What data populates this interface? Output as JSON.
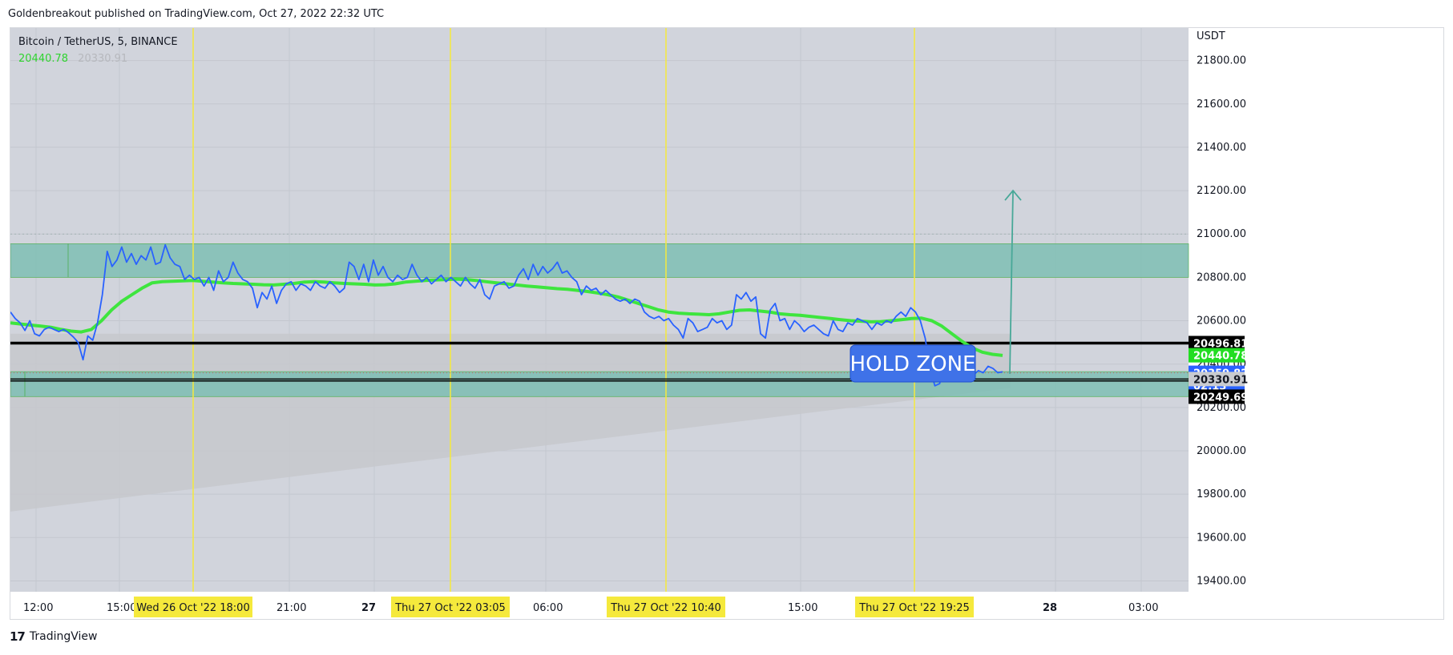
{
  "header": {
    "published": "Goldenbreakout published on TradingView.com, Oct 27, 2022 22:32 UTC"
  },
  "symbol": {
    "name": "Bitcoin / TetherUS, 5, BINANCE",
    "value_green": "20440.78",
    "value_gray": "20330.91"
  },
  "footer": {
    "logo": "17",
    "brand": "TradingView"
  },
  "annotation": {
    "hold_zone": "HOLD ZONE"
  },
  "colors": {
    "background": "#d1d4dc",
    "zone_fill": "#7fbfb5",
    "price_line": "#2962ff",
    "ma_line": "#3ee53e",
    "vertical_marker": "#f5e93c",
    "hold_zone_box": "#3f72e8",
    "arrow": "#48a898"
  },
  "chart_data": {
    "type": "line",
    "ylabel": "USDT",
    "ylim": [
      19350,
      21950
    ],
    "y_ticks": [
      "21800.00",
      "21600.00",
      "21400.00",
      "21200.00",
      "21000.00",
      "20800.00",
      "20600.00",
      "20400.00",
      "20200.00",
      "20000.00",
      "19800.00",
      "19600.00",
      "19400.00"
    ],
    "x_labels": [
      "12:00",
      "15:00",
      "21:00",
      "27",
      "06:00",
      "15:00",
      "28",
      "03:00"
    ],
    "x_markers": [
      "Wed 26 Oct '22   18:00",
      "Thu 27 Oct '22   03:05",
      "Thu 27 Oct '22   10:40",
      "Thu 27 Oct '22   19:25"
    ],
    "price_labels": [
      {
        "label": "20496.81",
        "bg": "#000000",
        "fg": "#ffffff"
      },
      {
        "label": "20440.78",
        "bg": "#22dd22",
        "fg": "#ffffff"
      },
      {
        "label": "20359.82",
        "bg": "#2962ff",
        "fg": "#ffffff"
      },
      {
        "label": "02:13",
        "bg": "#2962ff",
        "fg": "#ffffff"
      },
      {
        "label": "20330.91",
        "bg": "#c9cbd0",
        "fg": "#131722"
      },
      {
        "label": "20249.69",
        "bg": "#000000",
        "fg": "#ffffff"
      }
    ],
    "zones": [
      {
        "from": 20800,
        "to": 20955
      },
      {
        "from": 20250,
        "to": 20365
      }
    ],
    "series": [
      {
        "values": [
          20640,
          20610,
          20590,
          20555,
          20600,
          20540,
          20530,
          20560,
          20570,
          20560,
          20550,
          20560,
          20545,
          20525,
          20500,
          20420,
          20530,
          20510,
          20590,
          20720,
          20920,
          20850,
          20880,
          20940,
          20870,
          20910,
          20860,
          20900,
          20880,
          20940,
          20860,
          20870,
          20950,
          20890,
          20860,
          20850,
          20790,
          20810,
          20790,
          20800,
          20760,
          20800,
          20740,
          20830,
          20780,
          20800,
          20870,
          20820,
          20790,
          20780,
          20750,
          20660,
          20730,
          20700,
          20760,
          20680,
          20740,
          20770,
          20780,
          20740,
          20770,
          20760,
          20740,
          20780,
          20760,
          20750,
          20780,
          20760,
          20730,
          20750,
          20870,
          20850,
          20790,
          20860,
          20780,
          20880,
          20810,
          20850,
          20800,
          20780,
          20810,
          20790,
          20800,
          20860,
          20810,
          20780,
          20800,
          20770,
          20790,
          20810,
          20780,
          20800,
          20780,
          20760,
          20800,
          20770,
          20750,
          20790,
          20720,
          20700,
          20760,
          20770,
          20780,
          20750,
          20760,
          20810,
          20840,
          20790,
          20860,
          20810,
          20850,
          20820,
          20840,
          20870,
          20820,
          20830,
          20800,
          20780,
          20720,
          20760,
          20740,
          20750,
          20720,
          20740,
          20720,
          20700,
          20690,
          20700,
          20680,
          20700,
          20690,
          20640,
          20620,
          20610,
          20620,
          20600,
          20610,
          20580,
          20560,
          20520,
          20610,
          20590,
          20550,
          20560,
          20570,
          20610,
          20590,
          20600,
          20560,
          20580,
          20720,
          20700,
          20730,
          20690,
          20710,
          20540,
          20520,
          20650,
          20680,
          20600,
          20610,
          20560,
          20600,
          20580,
          20550,
          20570,
          20580,
          20560,
          20540,
          20530,
          20600,
          20560,
          20550,
          20590,
          20580,
          20610,
          20600,
          20590,
          20560,
          20590,
          20580,
          20600,
          20590,
          20620,
          20640,
          20620,
          20660,
          20640,
          20600,
          20520,
          20380,
          20300,
          20310,
          20430,
          20380,
          20370,
          20330,
          20340,
          20320,
          20350,
          20370,
          20360,
          20390,
          20380,
          20360,
          20365
        ]
      },
      {
        "values": [
          20590,
          20585,
          20580,
          20575,
          20570,
          20560,
          20552,
          20548,
          20560,
          20600,
          20650,
          20690,
          20720,
          20750,
          20775,
          20780,
          20782,
          20784,
          20786,
          20782,
          20778,
          20775,
          20772,
          20770,
          20768,
          20766,
          20765,
          20768,
          20772,
          20778,
          20780,
          20778,
          20775,
          20772,
          20770,
          20768,
          20765,
          20766,
          20770,
          20778,
          20782,
          20786,
          20788,
          20790,
          20792,
          20790,
          20786,
          20780,
          20775,
          20770,
          20765,
          20760,
          20756,
          20752,
          20748,
          20745,
          20740,
          20735,
          20728,
          20720,
          20710,
          20695,
          20680,
          20665,
          20650,
          20640,
          20635,
          20632,
          20630,
          20628,
          20632,
          20640,
          20648,
          20650,
          20645,
          20640,
          20632,
          20628,
          20625,
          20620,
          20615,
          20610,
          20605,
          20600,
          20598,
          20595,
          20596,
          20600,
          20605,
          20610,
          20612,
          20600,
          20575,
          20540,
          20505,
          20475,
          20455,
          20445,
          20440
        ]
      }
    ]
  }
}
